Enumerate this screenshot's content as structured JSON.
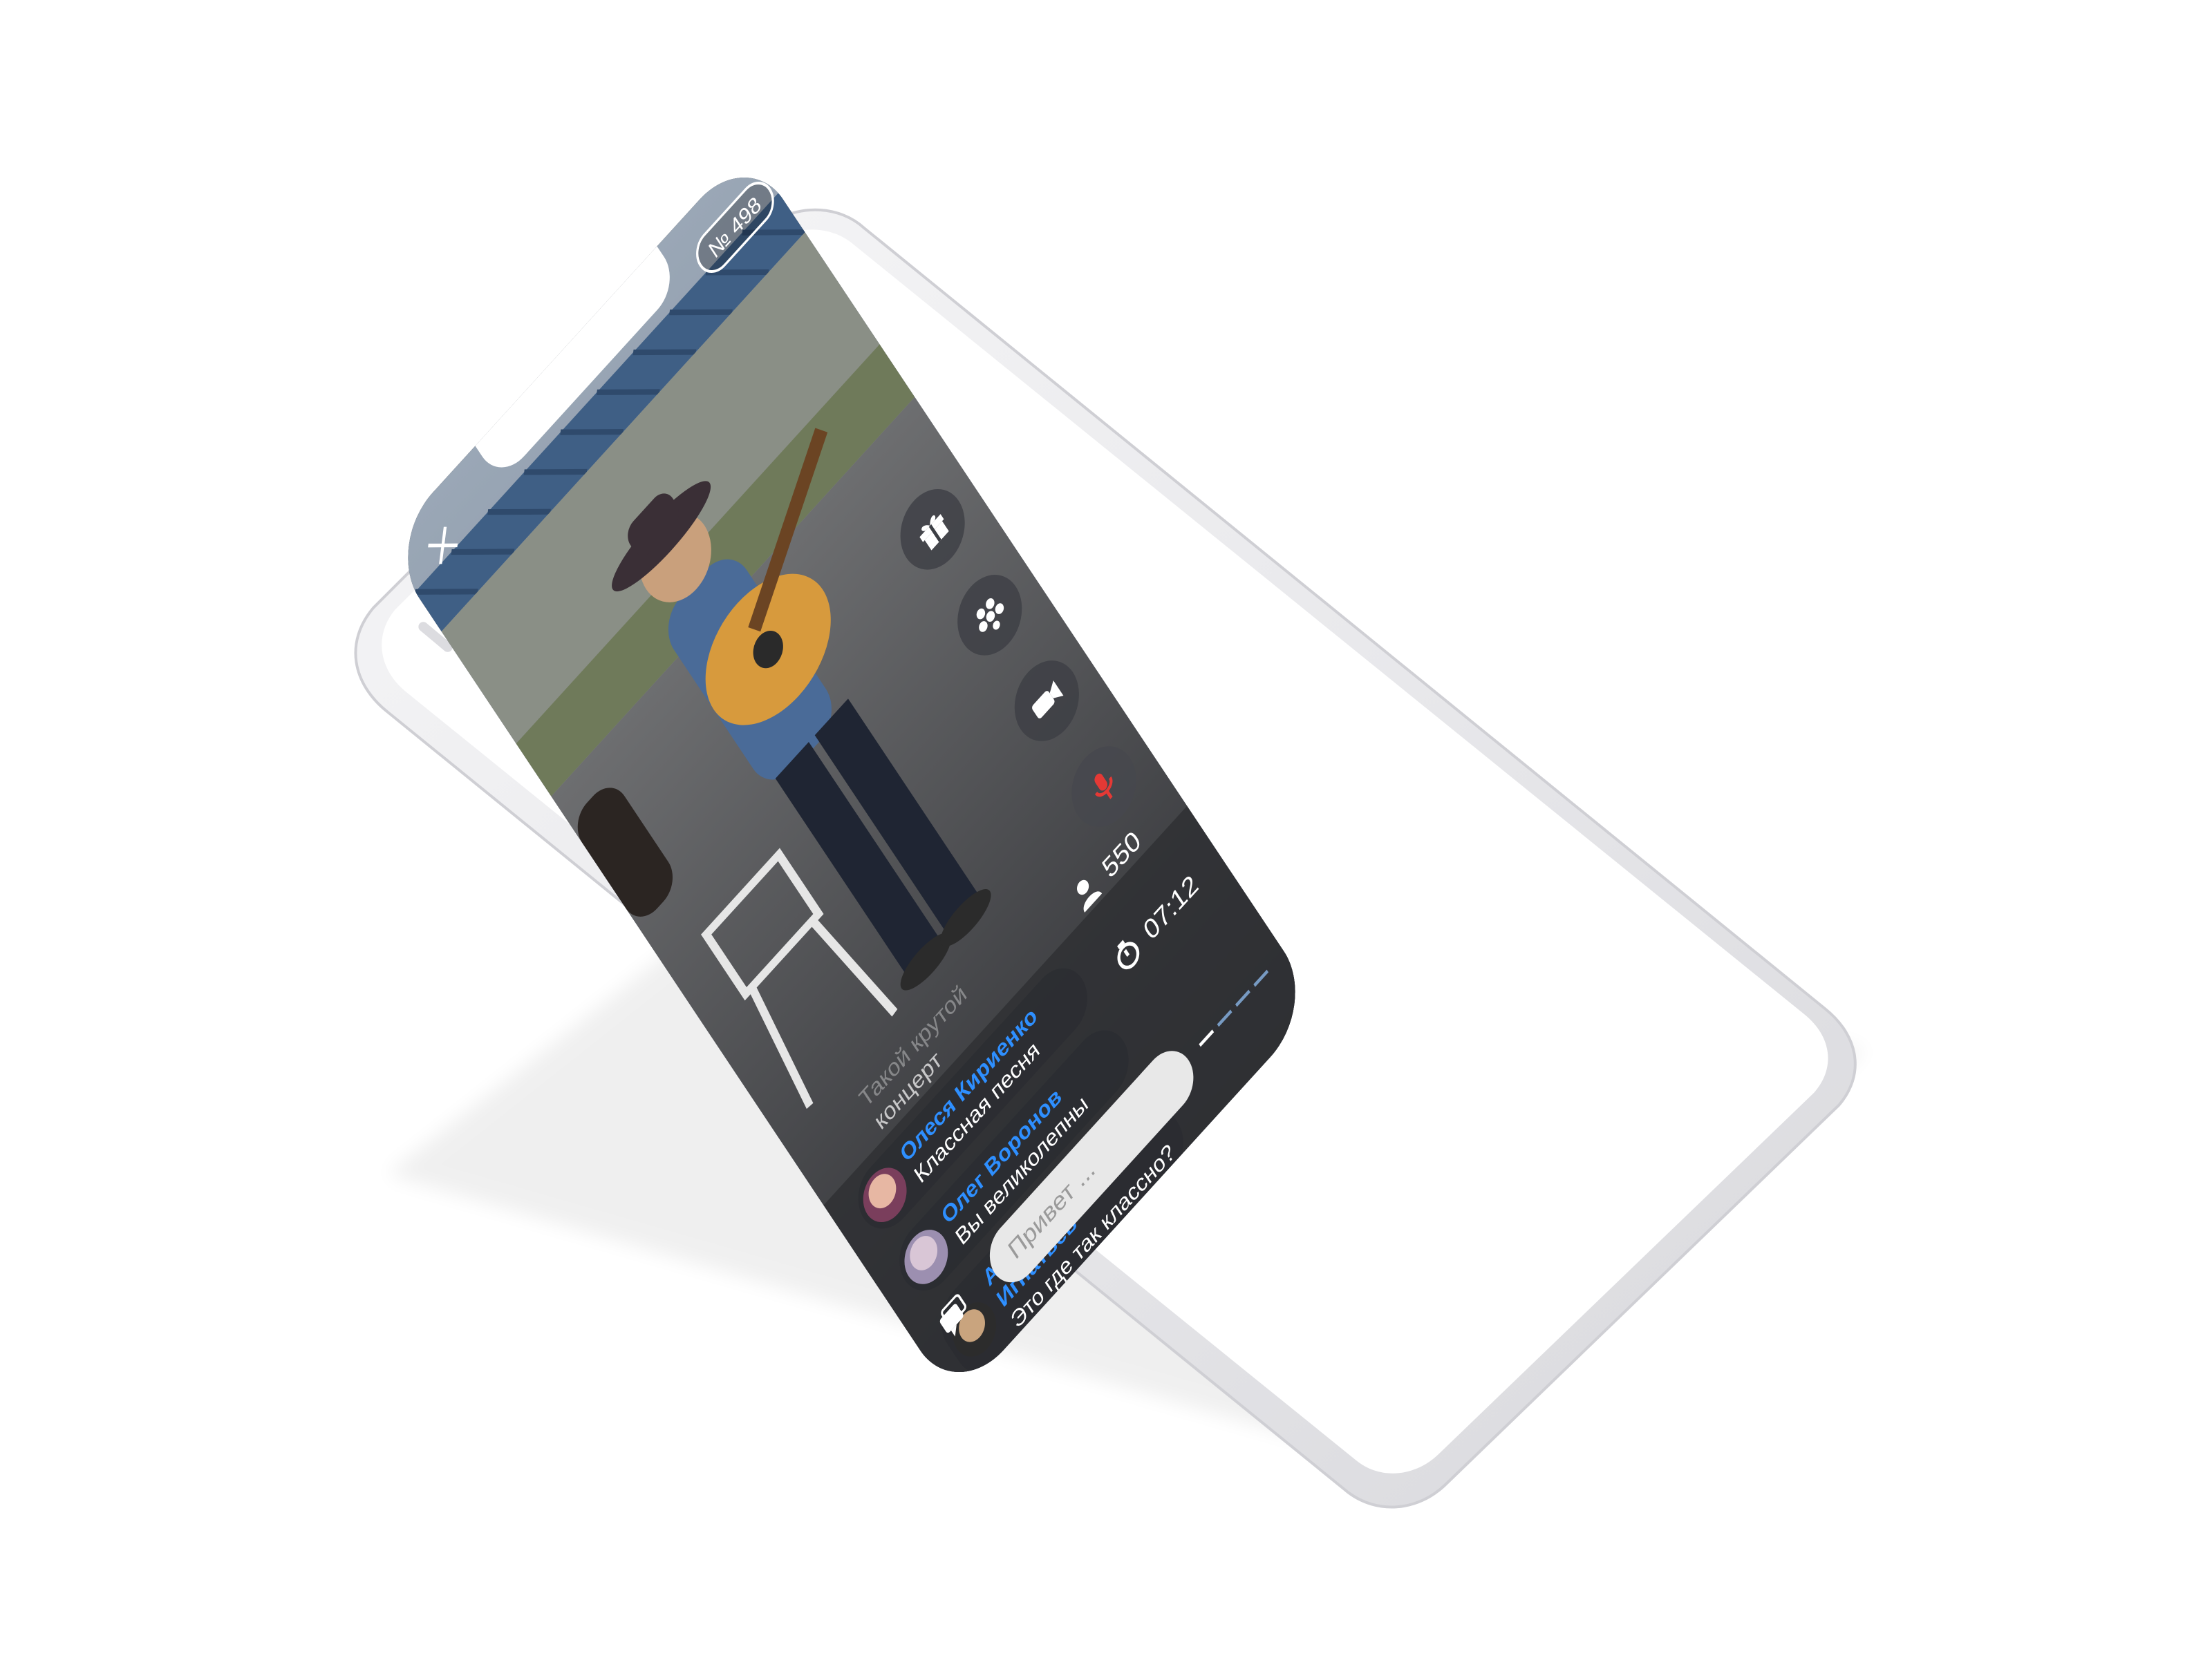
{
  "stream": {
    "badge": "№ 498",
    "viewers": "550",
    "timer": "07:12"
  },
  "actions": {
    "gift_icon": "gift-icon",
    "effects_icon": "effects-icon",
    "camera_icon": "video-camera-icon",
    "mic_icon": "microphone-icon",
    "mic_color": "#e53935"
  },
  "chat": {
    "faded_line_1": "Такой крутой",
    "faded_line_2": "концерт",
    "messages": [
      {
        "name": "Олеся Кириенко",
        "text": "Классная песня"
      },
      {
        "name": "Олег Воронов",
        "text": "Вы великолепны"
      },
      {
        "name": "Александр Игнатьев",
        "text": "Это где так классно?"
      }
    ],
    "input_placeholder": "Привет ...",
    "name_color": "#2e8fff"
  }
}
